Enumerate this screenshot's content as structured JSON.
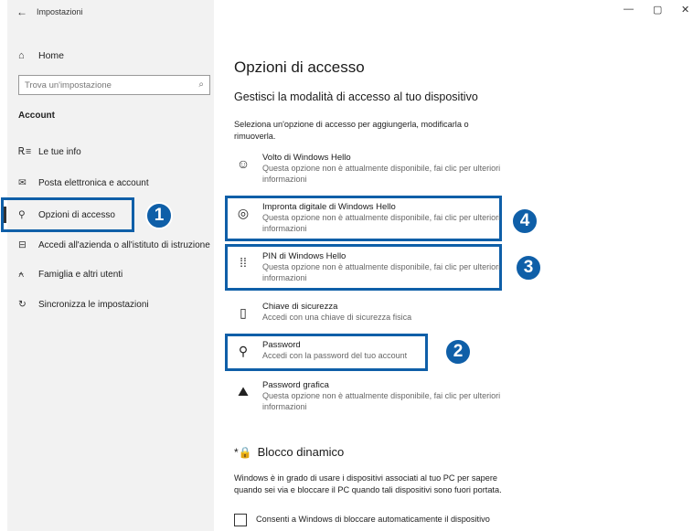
{
  "window": {
    "title": "Impostazioni",
    "back_icon": "←",
    "minimize": "—",
    "maximize": "▢",
    "close": "✕"
  },
  "sidebar": {
    "home": {
      "icon": "⌂",
      "label": "Home"
    },
    "search": {
      "placeholder": "Trova un'impostazione",
      "icon": "⌕"
    },
    "section_label": "Account",
    "items": [
      {
        "icon": "Ꭱ≡",
        "label": "Le tue info"
      },
      {
        "icon": "✉",
        "label": "Posta elettronica e account"
      },
      {
        "icon": "⚲",
        "label": "Opzioni di accesso"
      },
      {
        "icon": "⊟",
        "label": "Accedi all'azienda o all'istituto di istruzione"
      },
      {
        "icon": "⍲",
        "label": "Famiglia e altri utenti"
      },
      {
        "icon": "↻",
        "label": "Sincronizza le impostazioni"
      }
    ]
  },
  "main": {
    "title": "Opzioni di accesso",
    "subtitle": "Gestisci la modalità di accesso al tuo dispositivo",
    "intro": "Seleziona un'opzione di accesso per aggiungerla, modificarla o rimuoverla.",
    "options": [
      {
        "icon": "☺",
        "title": "Volto di Windows Hello",
        "desc": "Questa opzione non è attualmente disponibile, fai clic per ulteriori informazioni"
      },
      {
        "icon": "◎",
        "title": "Impronta digitale di Windows Hello",
        "desc": "Questa opzione non è attualmente disponibile, fai clic per ulteriori informazioni"
      },
      {
        "icon": "⁞⁞",
        "title": "PIN di Windows Hello",
        "desc": "Questa opzione non è attualmente disponibile, fai clic per ulteriori informazioni"
      },
      {
        "icon": "▯",
        "title": "Chiave di sicurezza",
        "desc": "Accedi con una chiave di sicurezza fisica"
      },
      {
        "icon": "⚲",
        "title": "Password",
        "desc": "Accedi con la password del tuo account"
      },
      {
        "icon": "⛰",
        "title": "Password grafica",
        "desc": "Questa opzione non è attualmente disponibile, fai clic per ulteriori informazioni"
      }
    ],
    "dynamic_lock": {
      "icon": "*🔒",
      "title": "Blocco dinamico",
      "text": "Windows è in grado di usare i dispositivi associati al tuo PC per sapere quando sei via e bloccare il PC quando tali dispositivi sono fuori portata.",
      "checkbox_label": "Consenti a Windows di bloccare automaticamente il dispositivo"
    }
  },
  "badges": [
    "1",
    "2",
    "3",
    "4"
  ],
  "colors": {
    "highlight": "#0f5fa8",
    "sidebar_bg": "#f2f2f2"
  }
}
